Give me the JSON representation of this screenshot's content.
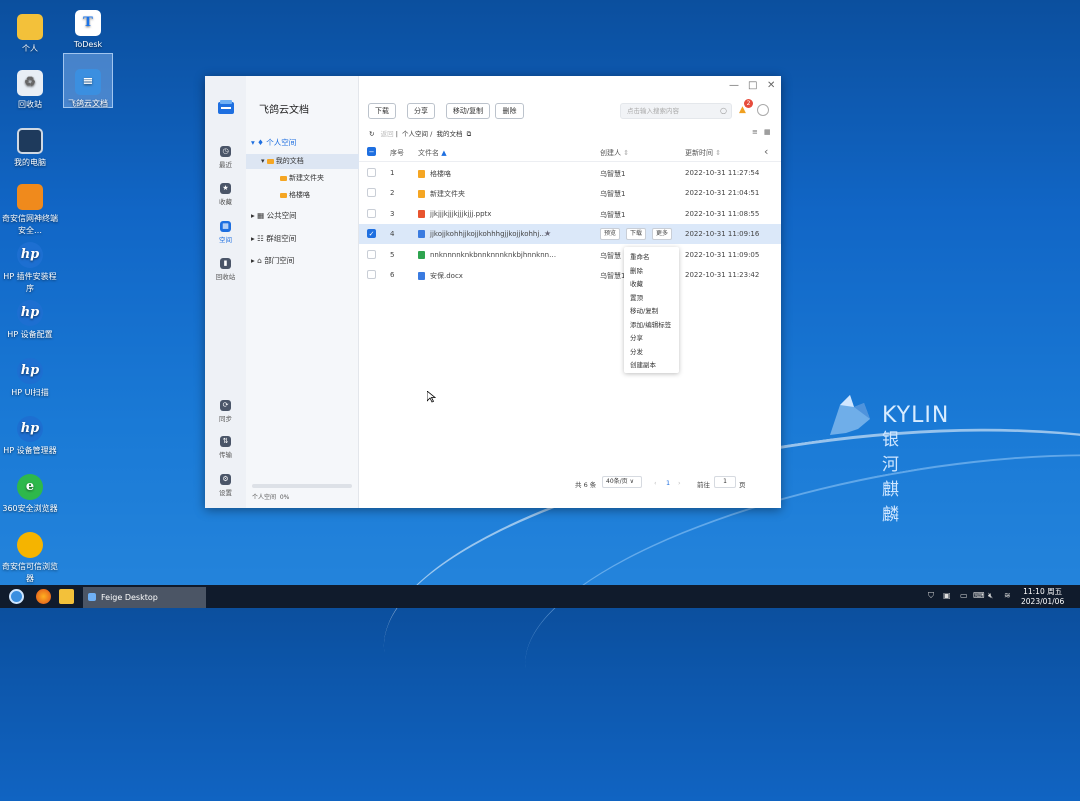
{
  "desktop": {
    "icons": [
      {
        "label": "个人"
      },
      {
        "label": "ToDesk"
      },
      {
        "label": "回收站"
      },
      {
        "label": "飞鸽云文档"
      },
      {
        "label": "我的电脑"
      },
      {
        "label": "奇安信网神终端安全…"
      },
      {
        "label": "HP 插件安装程序"
      },
      {
        "label": "HP 设备配置"
      },
      {
        "label": "HP UI扫描"
      },
      {
        "label": "HP 设备管理器"
      },
      {
        "label": "360安全浏览器"
      },
      {
        "label": "奇安信可信浏览器"
      }
    ],
    "brand_en": "KYLIN",
    "brand_cn": "银河麒麟"
  },
  "app": {
    "title": "飞鸽云文档",
    "rail": [
      {
        "label": "最近"
      },
      {
        "label": "收藏"
      },
      {
        "label": "空间"
      },
      {
        "label": "回收站"
      },
      {
        "label": "同步"
      },
      {
        "label": "传输"
      },
      {
        "label": "设置"
      }
    ],
    "tree": {
      "personal": "个人空间",
      "my_docs": "我的文档",
      "new_folder": "新建文件夹",
      "gezhu": "格楼咯",
      "public": "公共空间",
      "group": "群组空间",
      "dept": "部门空间"
    },
    "storage_label": "个人空间",
    "storage_pct": "0%",
    "toolbar": {
      "download": "下载",
      "share": "分享",
      "move_copy": "移动/复制",
      "delete": "删除",
      "search_placeholder": "点击输入搜索内容",
      "notif_count": "2"
    },
    "breadcrumb": {
      "back": "返回",
      "level1": "个人空间",
      "level2": "我的文档"
    },
    "columns": {
      "index": "序号",
      "name": "文件名",
      "creator": "创建人",
      "updated": "更新时间"
    },
    "rows": [
      {
        "index": "1",
        "name": "格楼咯",
        "creator": "乌智慧1",
        "updated": "2022-10-31 11:27:54"
      },
      {
        "index": "2",
        "name": "新建文件夹",
        "creator": "乌智慧1",
        "updated": "2022-10-31 21:04:51"
      },
      {
        "index": "3",
        "name": "jjkjjjkjjjkjjjkjjj.pptx",
        "creator": "乌智慧1",
        "updated": "2022-10-31 11:08:55"
      },
      {
        "index": "4",
        "name": "jjkojjkohhjjkojjkohhhgjjkojjkohhj…",
        "creator": "",
        "updated": "2022-10-31 11:09:16"
      },
      {
        "index": "5",
        "name": "nnknnnnknkbnnknnnknkbjhnnknn…",
        "creator": "乌智慧",
        "updated": "2022-10-31 11:09:05"
      },
      {
        "index": "6",
        "name": "安保.docx",
        "creator": "乌智慧1",
        "updated": "2022-10-31 11:23:42"
      }
    ],
    "row_actions": {
      "preview": "预览",
      "download": "下载",
      "more": "更多"
    },
    "context_menu": [
      "重命名",
      "删除",
      "收藏",
      "置顶",
      "移动/复制",
      "添加/编辑标签",
      "分享",
      "分发",
      "创建副本"
    ],
    "pager": {
      "total": "共 6 条",
      "page_size": "40条/页",
      "current": "1",
      "goto_label": "前往",
      "goto_value": "1",
      "page_unit": "页"
    }
  },
  "taskbar": {
    "app_label": "Feige Desktop",
    "time": "11:10 周五",
    "date": "2023/01/06"
  }
}
